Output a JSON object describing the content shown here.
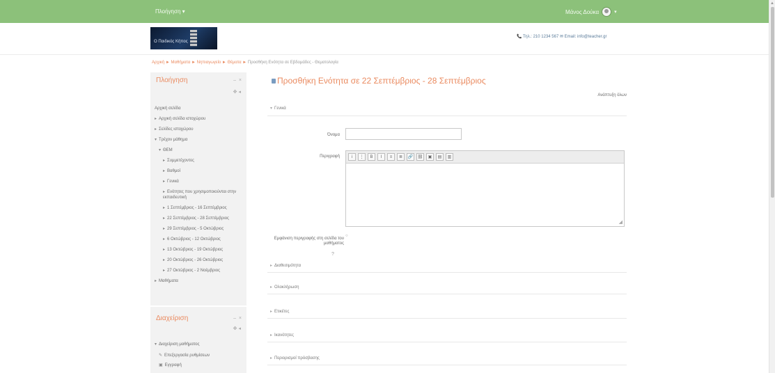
{
  "topbar": {
    "brand": "Πλοήγηση ▾",
    "user_name": "Μάνος Δούκα",
    "caret": "▾",
    "color": "#8cc17a"
  },
  "logo": {
    "label": "Ο Παιδικός Κήπος"
  },
  "contact": "📞 Τηλ.: 210 1234 567 ✉ Email: info@teacher.gr",
  "breadcrumb": {
    "links": [
      "Αρχική",
      "Μαθήματα",
      "Νηπιαγωγείο",
      "Θέματα"
    ],
    "current": "Προσθήκη Ενότητα σε Εβδομάδες - Θεματολογία"
  },
  "navigation": {
    "title": "Πλοήγηση",
    "controls": "– ×",
    "move": "✥ ◂",
    "items": [
      {
        "label": "Αρχική σελίδα",
        "indent": 0,
        "arrow": ""
      },
      {
        "label": "Αρχική σελίδα ιστοχώρου",
        "indent": 0,
        "arrow": "▸"
      },
      {
        "label": "Σελίδες ιστοχώρου",
        "indent": 0,
        "arrow": "▸"
      },
      {
        "label": "Τρέχον μάθημα",
        "indent": 0,
        "arrow": "▾"
      },
      {
        "label": "ΘΕΜ",
        "indent": 1,
        "arrow": "▾"
      },
      {
        "label": "Συμμετέχοντες",
        "indent": 2,
        "arrow": "▸"
      },
      {
        "label": "Βαθμοί",
        "indent": 2,
        "arrow": "▸"
      },
      {
        "label": "Γενικά",
        "indent": 2,
        "arrow": "▸"
      },
      {
        "label": "Ενότητες που χρησιμοποιούνται στην εκπαιδευτική",
        "indent": 2,
        "arrow": "▸"
      },
      {
        "label": "1 Σεπτέμβριος - 16 Σεπτέμβριος",
        "indent": 2,
        "arrow": "▸"
      },
      {
        "label": "22 Σεπτέμβριος - 28 Σεπτέμβριος",
        "indent": 2,
        "arrow": "▸"
      },
      {
        "label": "29 Σεπτέμβριος - 5 Οκτώβριος",
        "indent": 2,
        "arrow": "▸"
      },
      {
        "label": "6 Οκτώβριος - 12 Οκτώβριος",
        "indent": 2,
        "arrow": "▸"
      },
      {
        "label": "13 Οκτώβριος - 19 Οκτώβριος",
        "indent": 2,
        "arrow": "▸"
      },
      {
        "label": "20 Οκτώβριος - 26 Οκτώβριος",
        "indent": 2,
        "arrow": "▸"
      },
      {
        "label": "27 Οκτώβριος - 2 Νοέμβριος",
        "indent": 2,
        "arrow": "▸"
      },
      {
        "label": "Μαθήματα",
        "indent": 0,
        "arrow": "▸"
      }
    ]
  },
  "settings": {
    "title": "Διαχείριση",
    "controls": "– ×",
    "move": "✥ ◂",
    "items": [
      {
        "label": "Διαχείριση μαθήματος",
        "arrow": "▾"
      },
      {
        "label": "Επεξεργασία ρυθμίσεων",
        "arrow": "✎"
      },
      {
        "label": "Εγγραφή",
        "arrow": "▣"
      }
    ]
  },
  "main": {
    "title": "Προσθήκη Ενότητα σε 22 Σεπτέμβριος - 28 Σεπτέμβριος",
    "expand_all": "Ανάπτυξη όλων",
    "sections": {
      "general": "Γενικά",
      "availability": "Διαθεσιμότητα",
      "activity_completion": "Ολοκλήρωση",
      "tags": "Ετικέτες",
      "competencies": "Ικανότητες",
      "restrict": "Περιορισμοί πρόσβασης"
    },
    "name_label": "Όνομα",
    "description_label": "Περιγραφή",
    "display_label": "Εμφάνιση περιγραφής στη σελίδα του μαθήματος",
    "editor_buttons": [
      "i",
      "⋮",
      "B",
      "I",
      "≡",
      "≣",
      "🔗",
      "⛓",
      "▣",
      "▤",
      "▥"
    ]
  }
}
